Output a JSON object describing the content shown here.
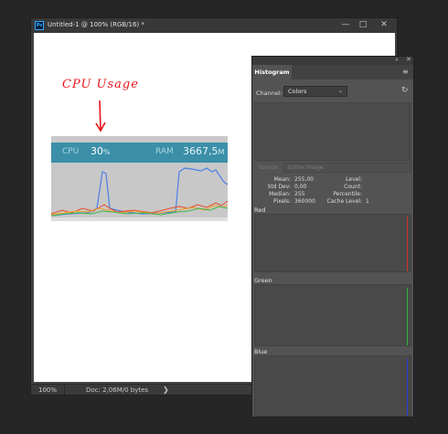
{
  "document": {
    "ps_logo": "Ps",
    "title": "Untitled-1 @ 100% (RGB/16) *",
    "controls": {
      "minimize": "—",
      "maximize": "□",
      "close": "✕"
    },
    "annotation": "CPU Usage",
    "screenshot": {
      "cpu_label": "CPU",
      "cpu_value": "30",
      "cpu_unit": "%",
      "ram_label": "RAM",
      "ram_value": "3667,5",
      "ram_unit": "M",
      "graph_colors": {
        "blue": "#4d7fe6",
        "red": "#e84a2a",
        "orange": "#f0a020",
        "green": "#3fb64a"
      }
    },
    "status": {
      "zoom": "100%",
      "doc_size": "Doc: 2,06M/0 bytes",
      "arrow": "❯"
    }
  },
  "histogram": {
    "tab": "Histogram",
    "collapse_glyph": "«",
    "close_glyph": "✕",
    "menu_glyph": "≡",
    "channel_label": "Channel:",
    "channel_value": "Colors",
    "source_label": "Source:",
    "source_value": "Entire Image",
    "stats": {
      "mean_label": "Mean:",
      "mean": "255,00",
      "std_label": "Std Dev:",
      "std": "0,00",
      "median_label": "Median:",
      "median": "255",
      "pixels_label": "Pixels:",
      "pixels": "360000",
      "level_label": "Level:",
      "level": "",
      "count_label": "Count:",
      "count": "",
      "percentile_label": "Percentile:",
      "percentile": "",
      "cache_label": "Cache Level:",
      "cache": "1"
    },
    "channels": [
      {
        "name": "Red",
        "color": "#d0312d"
      },
      {
        "name": "Green",
        "color": "#2fb53a"
      },
      {
        "name": "Blue",
        "color": "#2a3bd4"
      }
    ]
  }
}
